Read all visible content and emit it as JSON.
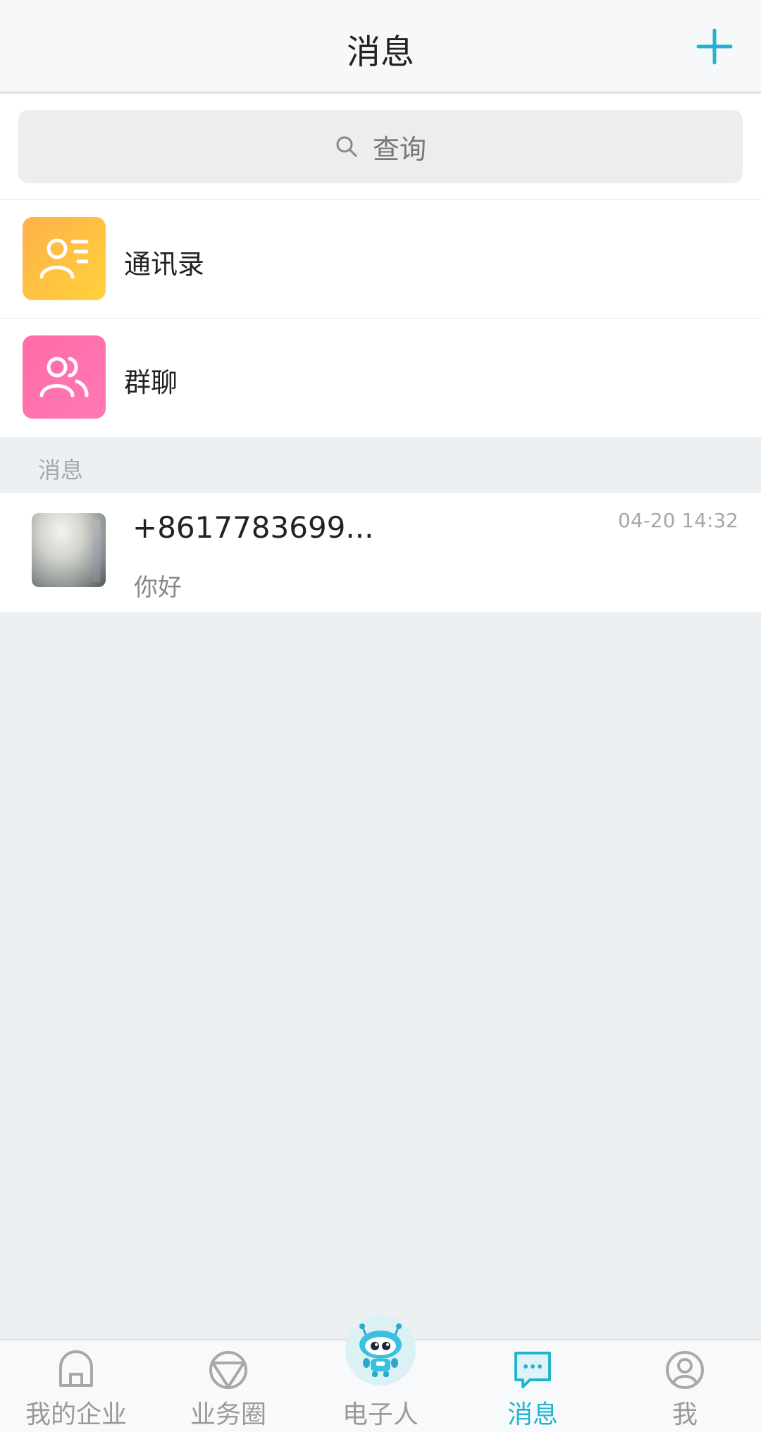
{
  "header": {
    "title": "消息",
    "add_icon": "plus-icon"
  },
  "search": {
    "placeholder": "查询",
    "icon": "search-icon"
  },
  "entries": [
    {
      "label": "通讯录",
      "icon": "contacts-icon",
      "color": "#ffc041"
    },
    {
      "label": "群聊",
      "icon": "group-chat-icon",
      "color": "#ff70ad"
    }
  ],
  "section": {
    "label": "消息"
  },
  "messages": [
    {
      "name": "+8617783699...",
      "time": "04-20 14:32",
      "preview": "你好",
      "avatar": "avatar-photo"
    }
  ],
  "tabbar": {
    "accent": "#20b4cf",
    "inactive_color": "#999999",
    "tabs": [
      {
        "label": "我的企业",
        "icon": "enterprise-icon",
        "active": false
      },
      {
        "label": "业务圈",
        "icon": "business-circle-icon",
        "active": false
      },
      {
        "label": "电子人",
        "icon": "robot-icon",
        "active": false
      },
      {
        "label": "消息",
        "icon": "message-icon",
        "active": true
      },
      {
        "label": "我",
        "icon": "profile-icon",
        "active": false
      }
    ]
  }
}
